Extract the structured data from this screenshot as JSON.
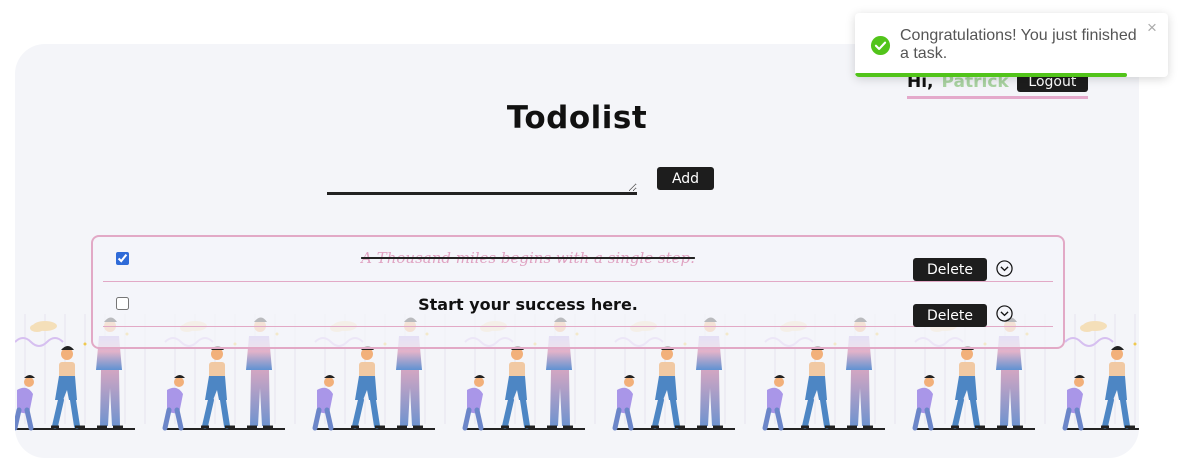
{
  "header": {
    "greeting": "Hi,",
    "username": "Patrick",
    "logout_label": "Logout"
  },
  "title": "Todolist",
  "new_task": {
    "value": "",
    "placeholder": ""
  },
  "add_label": "Add",
  "tasks": [
    {
      "text": "A Thousand miles begins with a single step.",
      "done": true,
      "delete_label": "Delete"
    },
    {
      "text": "Start your success here.",
      "done": false,
      "delete_label": "Delete"
    }
  ],
  "toast": {
    "message": "Congratulations! You just finished a task.",
    "close_symbol": "×",
    "icon": "check-circle-icon",
    "status_color": "#52c41a",
    "progress": 0.87
  },
  "colors": {
    "accent_pink": "#e2a9c6",
    "button_dark": "#1d1d1d",
    "username_green": "#a9d3a1",
    "card_bg": "#f4f5f9"
  }
}
